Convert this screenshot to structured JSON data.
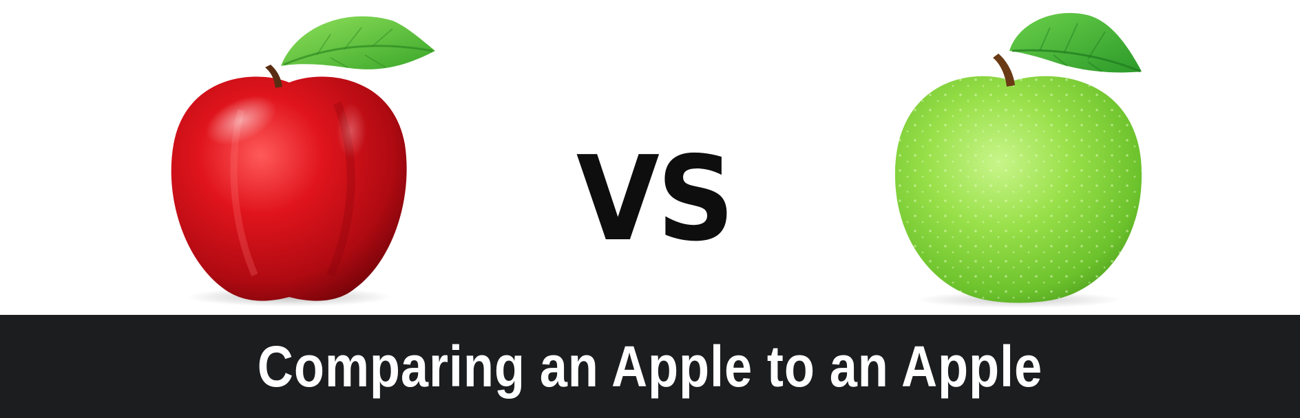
{
  "vs_label": "VS",
  "banner": {
    "title": "Comparing an Apple to an Apple"
  },
  "colors": {
    "background": "#ffffff",
    "banner": "#1b1d1e",
    "banner_text": "#ffffff",
    "vs_text": "#0e0e0e",
    "red_apple": "#c8101a",
    "green_apple": "#8fdb3a",
    "leaf": "#5fc43a"
  },
  "icons": {
    "left": "red-apple-icon",
    "right": "green-apple-icon"
  }
}
